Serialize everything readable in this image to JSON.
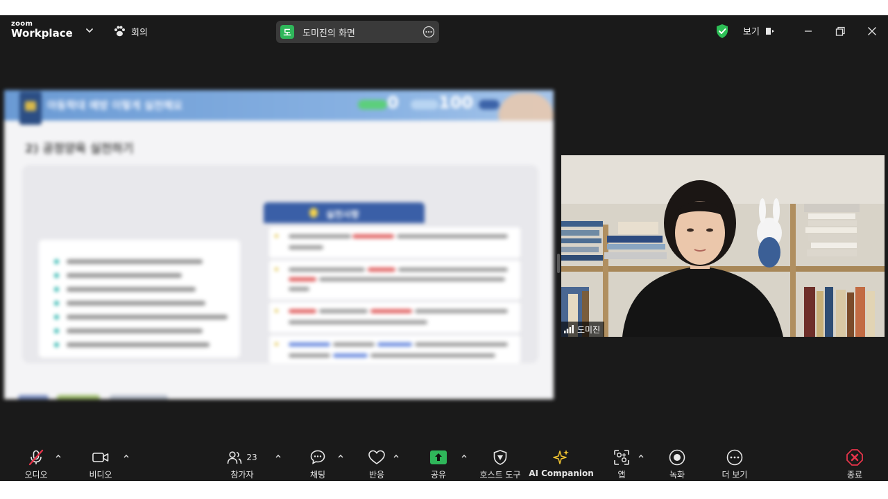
{
  "app": {
    "logo_line1": "zoom",
    "logo_line2": "Workplace",
    "meeting_label": "회의"
  },
  "share_pill": {
    "avatar_initial": "도",
    "label": "도미진의 화면"
  },
  "top_right": {
    "view_label": "보기"
  },
  "slide": {
    "title": "아동학대 예방 이렇게 실천해요",
    "number_left": "0",
    "number_right": "100",
    "subtitle": "2) 공정양육 실천하기",
    "tab_label": "실천사항"
  },
  "video": {
    "participant_name": "도미진"
  },
  "toolbar": {
    "audio": "오디오",
    "video": "비디오",
    "participants": "참가자",
    "participants_count": "23",
    "chat": "채팅",
    "reactions": "반응",
    "share": "공유",
    "host_tools": "호스트 도구",
    "ai_companion": "AI Companion",
    "apps": "앱",
    "record": "녹화",
    "more": "더 보기",
    "end": "종료"
  },
  "colors": {
    "background": "#1a1a1a",
    "share_green": "#2fb65a",
    "end_red": "#e5344a",
    "ai_gold": "#f2c531",
    "shield_green": "#2dbf56"
  }
}
